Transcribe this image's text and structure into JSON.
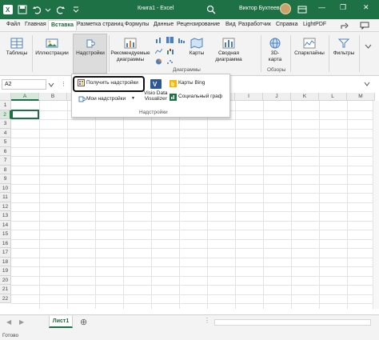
{
  "titlebar": {
    "title": "Книга1 - Excel",
    "user": "Виктор Бухтеев",
    "minimize": "—",
    "restore": "❐",
    "close": "✕"
  },
  "tabs": [
    "Файл",
    "Главная",
    "Вставка",
    "Разметка страниц",
    "Формулы",
    "Данные",
    "Рецензирование",
    "Вид",
    "Разработчик",
    "Справка",
    "LightPDF"
  ],
  "active_tab": "Вставка",
  "ribbon": {
    "tables": "Таблицы",
    "illustrations": "Иллюстрации",
    "addins": "Надстройки",
    "recommended_charts_1": "Рекомендуемые",
    "recommended_charts_2": "диаграммы",
    "maps": "Карты",
    "pivot_chart_1": "Сводная",
    "pivot_chart_2": "диаграмма",
    "map3d_1": "3D-",
    "map3d_2": "карта",
    "sparklines": "Спарклайны",
    "filters": "Фильтры",
    "group_charts": "Диаграммы",
    "group_tours": "Обзоры"
  },
  "formula_bar": {
    "name_box": "A2",
    "fx": "fx"
  },
  "grid": {
    "columns": [
      "A",
      "B",
      "C",
      "D",
      "E",
      "F",
      "G",
      "H",
      "I",
      "J",
      "K",
      "L",
      "M"
    ],
    "rows": [
      "1",
      "2",
      "3",
      "4",
      "5",
      "6",
      "7",
      "8",
      "9",
      "10",
      "11",
      "12",
      "13",
      "14",
      "15",
      "16",
      "17",
      "18",
      "19",
      "20",
      "21",
      "22"
    ]
  },
  "addins_panel": {
    "get_addins": "Получить надстройки",
    "my_addins": "Мои надстройки",
    "visio_1": "Visio Data",
    "visio_2": "Visualizer",
    "bing_maps": "Карты Bing",
    "people_graph": "Социальный граф",
    "group_label": "Надстройки"
  },
  "sheet_tab": "Лист1",
  "status": "Готово",
  "colors": {
    "brand": "#1e7145",
    "ribbon_bg": "#f3f3f3"
  }
}
